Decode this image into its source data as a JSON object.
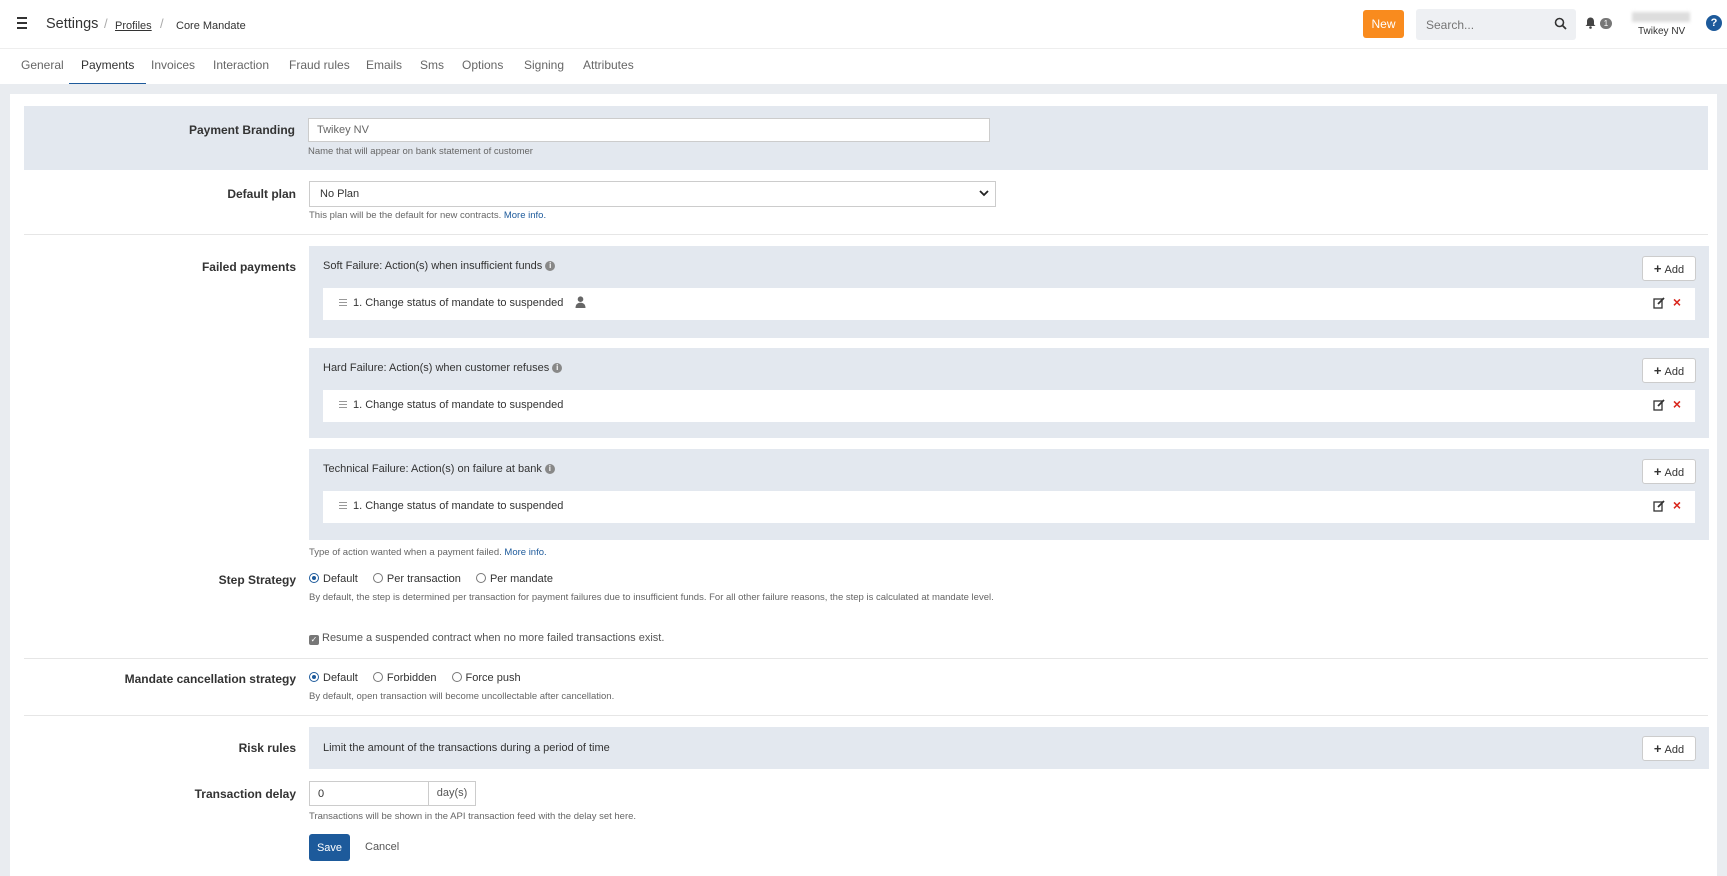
{
  "header": {
    "title": "Settings",
    "breadcrumb_separator": "/",
    "breadcrumb_profiles": "Profiles",
    "breadcrumb_current": "Core Mandate",
    "new_button": "New",
    "search_placeholder": "Search...",
    "notification_count": "1",
    "user_company": "Twikey NV",
    "help_label": "?"
  },
  "tabs": [
    "General",
    "Payments",
    "Invoices",
    "Interaction",
    "Fraud rules",
    "Emails",
    "Sms",
    "Options",
    "Signing",
    "Attributes"
  ],
  "active_tab": "Payments",
  "payment_branding": {
    "label": "Payment Branding",
    "value": "Twikey NV",
    "help": "Name that will appear on bank statement of customer"
  },
  "default_plan": {
    "label": "Default plan",
    "value": "No Plan",
    "help": "This plan will be the default for new contracts.",
    "more_info": "More info."
  },
  "failed_payments": {
    "label": "Failed payments",
    "add_label": "Add",
    "soft": {
      "title": "Soft Failure: Action(s) when insufficient funds",
      "action": "1. Change status of mandate to suspended"
    },
    "hard": {
      "title": "Hard Failure: Action(s) when customer refuses",
      "action": "1. Change status of mandate to suspended"
    },
    "technical": {
      "title": "Technical Failure: Action(s) on failure at bank",
      "action": "1. Change status of mandate to suspended"
    },
    "help": "Type of action wanted when a payment failed.",
    "more_info": "More info."
  },
  "step_strategy": {
    "label": "Step Strategy",
    "options": [
      "Default",
      "Per transaction",
      "Per mandate"
    ],
    "selected": "Default",
    "help": "By default, the step is determined per transaction for payment failures due to insufficient funds. For all other failure reasons, the step is calculated at mandate level.",
    "resume_label": "Resume a suspended contract when no more failed transactions exist.",
    "resume_checked": true
  },
  "mandate_cancellation": {
    "label": "Mandate cancellation strategy",
    "options": [
      "Default",
      "Forbidden",
      "Force push"
    ],
    "selected": "Default",
    "help": "By default, open transaction will become uncollectable after cancellation."
  },
  "risk_rules": {
    "label": "Risk rules",
    "text": "Limit the amount of the transactions during a period of time",
    "add_label": "Add"
  },
  "transaction_delay": {
    "label": "Transaction delay",
    "value": "0",
    "unit": "day(s)",
    "help": "Transactions will be shown in the API transaction feed with the delay set here."
  },
  "actions": {
    "save": "Save",
    "cancel": "Cancel"
  },
  "colors": {
    "brand_blue": "#1d5a9b",
    "new_orange": "#f98b1e",
    "row_highlight": "#e3e8ef",
    "delete_red": "#d9261c"
  }
}
